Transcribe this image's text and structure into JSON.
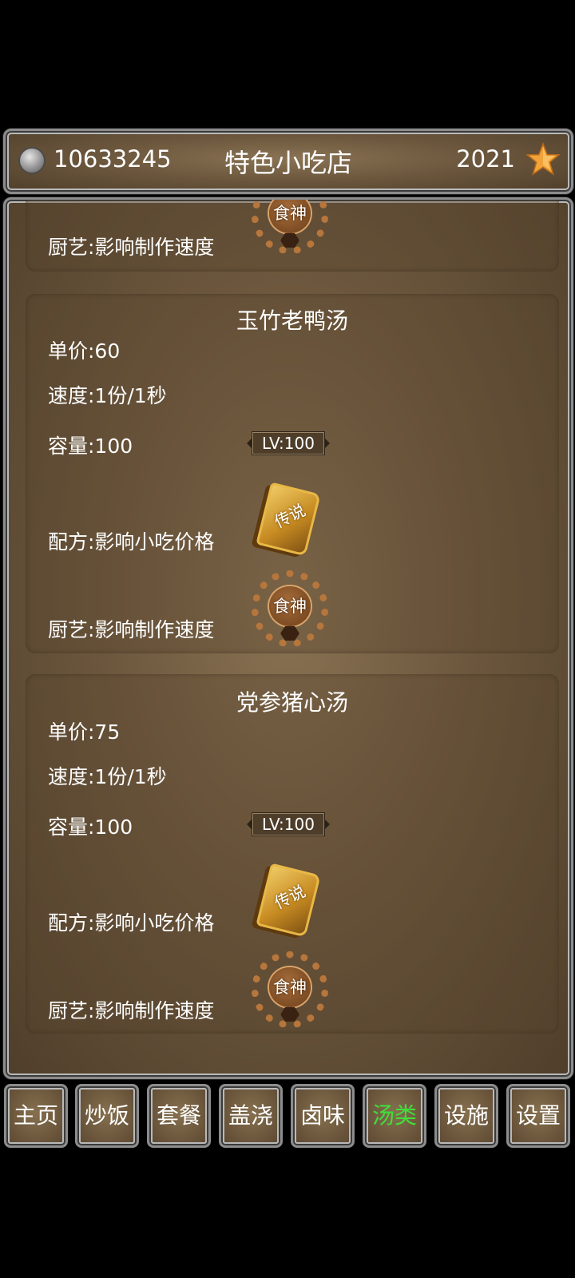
{
  "header": {
    "coins": "10633245",
    "title": "特色小吃店",
    "stars": "2021",
    "coin_icon": "silver-coin-icon",
    "star_icon": "star-icon",
    "star_color": "#f2a33a"
  },
  "items": [
    {
      "name": "",
      "skill": "厨艺:影响制作速度",
      "chef_badge": "食神"
    },
    {
      "name": "玉竹老鸭汤",
      "price": "单价:60",
      "speed": "速度:1份/1秒",
      "capacity": "容量:100",
      "level": "LV:100",
      "recipe": "配方:影响小吃价格",
      "recipe_badge": "传说",
      "skill": "厨艺:影响制作速度",
      "chef_badge": "食神"
    },
    {
      "name": "党参猪心汤",
      "price": "单价:75",
      "speed": "速度:1份/1秒",
      "capacity": "容量:100",
      "level": "LV:100",
      "recipe": "配方:影响小吃价格",
      "recipe_badge": "传说",
      "skill": "厨艺:影响制作速度",
      "chef_badge": "食神"
    }
  ],
  "nav": {
    "tabs": [
      {
        "label": "主页"
      },
      {
        "label": "炒饭"
      },
      {
        "label": "套餐"
      },
      {
        "label": "盖浇"
      },
      {
        "label": "卤味"
      },
      {
        "label": "汤类"
      },
      {
        "label": "设施"
      },
      {
        "label": "设置"
      }
    ],
    "active_tab": "汤类",
    "active_color": "#3fe03a"
  }
}
